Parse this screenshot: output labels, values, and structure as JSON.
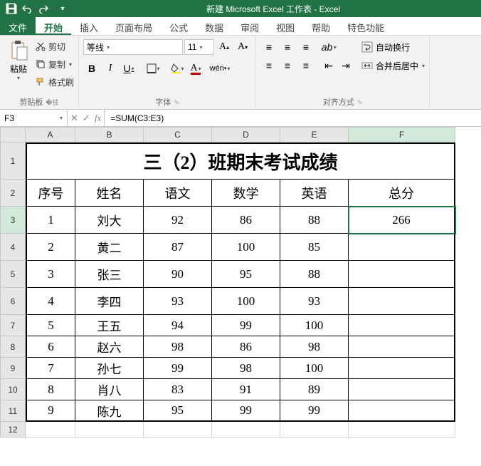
{
  "titlebar": {
    "title": "新建 Microsoft Excel 工作表 - Excel"
  },
  "qat": {
    "save": "save",
    "undo": "undo",
    "redo": "redo"
  },
  "tabs": {
    "file": "文件",
    "home": "开始",
    "insert": "插入",
    "layout": "页面布局",
    "formula": "公式",
    "data": "数据",
    "review": "审阅",
    "view": "视图",
    "help": "帮助",
    "special": "特色功能"
  },
  "ribbon": {
    "clipboard": {
      "label": "剪贴板",
      "paste": "粘贴",
      "cut": "剪切",
      "copy": "复制",
      "format_painter": "格式刷"
    },
    "font": {
      "label": "字体",
      "family": "等线",
      "size": "11",
      "bold": "B",
      "italic": "I",
      "underline": "U"
    },
    "align": {
      "label": "对齐方式",
      "wrap": "自动换行",
      "merge": "合并后居中"
    }
  },
  "namebox": "F3",
  "formula": "=SUM(C3:E3)",
  "cols": [
    "A",
    "B",
    "C",
    "D",
    "E",
    "F"
  ],
  "rows": [
    "1",
    "2",
    "3",
    "4",
    "5",
    "6",
    "7",
    "8",
    "9",
    "10",
    "11",
    "12"
  ],
  "sheet": {
    "title": "三（2）班期末考试成绩",
    "headers": [
      "序号",
      "姓名",
      "语文",
      "数学",
      "英语",
      "总分"
    ],
    "data": [
      [
        "1",
        "刘大",
        "92",
        "86",
        "88",
        "266"
      ],
      [
        "2",
        "黄二",
        "87",
        "100",
        "85",
        ""
      ],
      [
        "3",
        "张三",
        "90",
        "95",
        "88",
        ""
      ],
      [
        "4",
        "李四",
        "93",
        "100",
        "93",
        ""
      ],
      [
        "5",
        "王五",
        "94",
        "99",
        "100",
        ""
      ],
      [
        "6",
        "赵六",
        "98",
        "86",
        "98",
        ""
      ],
      [
        "7",
        "孙七",
        "99",
        "98",
        "100",
        ""
      ],
      [
        "8",
        "肖八",
        "83",
        "91",
        "89",
        ""
      ],
      [
        "9",
        "陈九",
        "95",
        "99",
        "99",
        ""
      ]
    ]
  },
  "chart_data": {
    "type": "table",
    "title": "三（2）班期末考试成绩",
    "columns": [
      "序号",
      "姓名",
      "语文",
      "数学",
      "英语",
      "总分"
    ],
    "rows": [
      {
        "序号": 1,
        "姓名": "刘大",
        "语文": 92,
        "数学": 86,
        "英语": 88,
        "总分": 266
      },
      {
        "序号": 2,
        "姓名": "黄二",
        "语文": 87,
        "数学": 100,
        "英语": 85,
        "总分": null
      },
      {
        "序号": 3,
        "姓名": "张三",
        "语文": 90,
        "数学": 95,
        "英语": 88,
        "总分": null
      },
      {
        "序号": 4,
        "姓名": "李四",
        "语文": 93,
        "数学": 100,
        "英语": 93,
        "总分": null
      },
      {
        "序号": 5,
        "姓名": "王五",
        "语文": 94,
        "数学": 99,
        "英语": 100,
        "总分": null
      },
      {
        "序号": 6,
        "姓名": "赵六",
        "语文": 98,
        "数学": 86,
        "英语": 98,
        "总分": null
      },
      {
        "序号": 7,
        "姓名": "孙七",
        "语文": 99,
        "数学": 98,
        "英语": 100,
        "总分": null
      },
      {
        "序号": 8,
        "姓名": "肖八",
        "语文": 83,
        "数学": 91,
        "英语": 89,
        "总分": null
      },
      {
        "序号": 9,
        "姓名": "陈九",
        "语文": 95,
        "数学": 99,
        "英语": 99,
        "总分": null
      }
    ]
  }
}
